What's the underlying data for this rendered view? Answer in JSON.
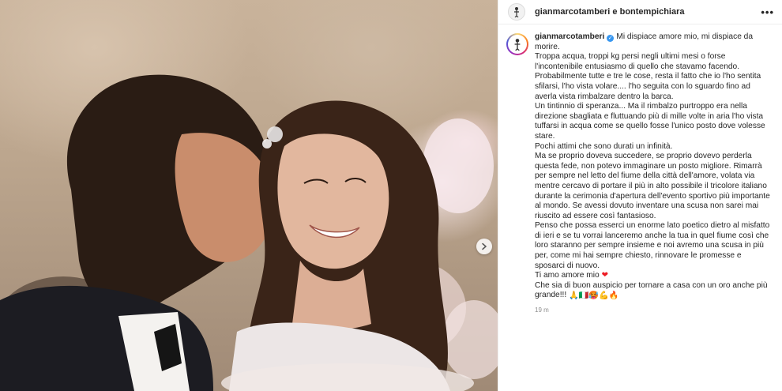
{
  "header": {
    "names": "gianmarcotamberi e bontempichiara",
    "more_label": "•••"
  },
  "post": {
    "username": "gianmarcotamberi",
    "caption_lines": [
      "Mi dispiace amore mio, mi dispiace da morire.",
      "Troppa acqua, troppi kg persi negli ultimi mesi o forse l'incontenibile entusiasmo di quello che stavamo facendo.",
      "Probabilmente tutte e tre le cose, resta il fatto che io l'ho sentita sfilarsi, l'ho vista volare.... l'ho seguita con lo sguardo fino ad averla vista rimbalzare dentro la barca.",
      "Un tintinnio di speranza... Ma il rimbalzo purtroppo era nella direzione sbagliata e fluttuando più di mille volte in aria l'ho vista tuffarsi in acqua come se quello fosse l'unico posto dove volesse stare.",
      "Pochi attimi che sono durati un infinità.",
      "Ma se proprio doveva succedere, se proprio dovevo perderla questa fede, non potevo immaginare un posto migliore. Rimarrà per sempre nel letto del fiume della città dell'amore, volata via mentre cercavo di portare il più in alto possibile il tricolore italiano durante la cerimonia d'apertura dell'evento sportivo più importante al mondo. Se avessi dovuto inventare una scusa non sarei mai riuscito ad essere così fantasioso.",
      "Penso che possa esserci un enorme lato poetico dietro al misfatto di ieri e se tu vorrai lanceremo anche la tua in quel fiume così che loro staranno per sempre insieme e noi avremo una scusa in più per, come mi hai sempre chiesto, rinnovare le promesse e sposarci di nuovo.",
      "Ti amo amore mio",
      "Che sia di buon auspicio per tornare a casa con un oro anche più grande!!!"
    ],
    "heart_emoji": "❤",
    "end_emojis": "🙏🇮🇹🥵💪🔥",
    "timestamp": "19 m"
  },
  "colors": {
    "verified": "#3897f0",
    "text": "#262626",
    "secondary": "#8e8e8e"
  },
  "icons": [
    "verified-badge-icon",
    "more-options-icon",
    "carousel-next-icon"
  ]
}
